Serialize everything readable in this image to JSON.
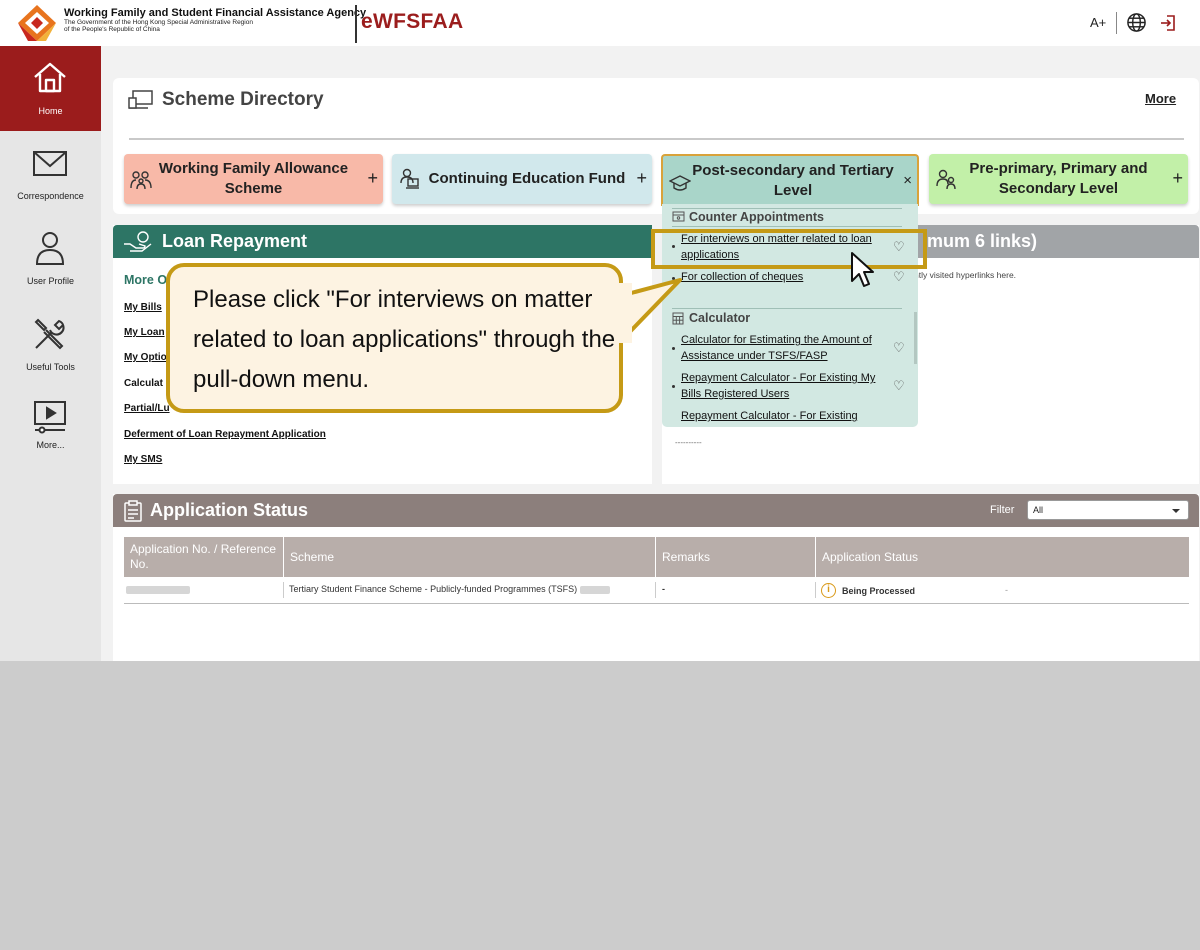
{
  "header": {
    "agency_name": "Working Family and Student Financial Assistance Agency",
    "agency_sub1": "The Government of the Hong Kong Special Administrative Region",
    "agency_sub2": "of the People's Republic of China",
    "brand": "eWFSFAA",
    "font_size_label": "A+"
  },
  "sidebar": {
    "items": [
      {
        "label": "Home",
        "icon": "home-icon",
        "active": true
      },
      {
        "label": "Correspondence",
        "icon": "envelope-icon"
      },
      {
        "label": "User Profile",
        "icon": "user-icon"
      },
      {
        "label": "Useful Tools",
        "icon": "tools-icon"
      },
      {
        "label": "More...",
        "icon": "video-icon"
      }
    ]
  },
  "scheme_directory": {
    "title": "Scheme Directory",
    "more": "More",
    "tiles": [
      {
        "label": "Working Family Allowance Scheme",
        "icon": "family-icon",
        "color": "#f8b9a8",
        "toggle": "+"
      },
      {
        "label": "Continuing Education Fund",
        "icon": "laptop-user-icon",
        "color": "#d1e8ec",
        "toggle": "+"
      },
      {
        "label": "Post-secondary and Tertiary Level",
        "icon": "graduation-cap-icon",
        "color": "#a9d5c9",
        "toggle": "×"
      },
      {
        "label": "Pre-primary, Primary and Secondary Level",
        "icon": "students-icon",
        "color": "#c2f0a8",
        "toggle": "+"
      }
    ]
  },
  "dropdown": {
    "sections": [
      {
        "title": "Counter Appointments",
        "links": [
          "For interviews on matter related to loan applications",
          "For collection of cheques"
        ]
      },
      {
        "title": "Calculator",
        "links": [
          "Calculator for Estimating the Amount of Assistance under TSFS/FASP",
          "Repayment Calculator - For Existing My Bills Registered Users",
          "Repayment Calculator - For Existing"
        ]
      }
    ]
  },
  "loan_repayment": {
    "title": "Loan Repayment",
    "more_heading": "More O",
    "links": [
      "My Bills",
      "My Loan",
      "My Optio",
      "Calculat",
      "Partial/Lu",
      "Deferment of Loan Repayment Application",
      "My SMS"
    ]
  },
  "quick_links": {
    "title_fragment": "imum 6 links)",
    "hint": "ntly visited hyperlinks here.",
    "placeholder": "----------"
  },
  "application_status": {
    "title": "Application Status",
    "filter_label": "Filter",
    "filter_value": "All",
    "columns": [
      "Application No. / Reference No.",
      "Scheme",
      "Remarks",
      "Application Status"
    ],
    "rows": [
      {
        "scheme": "Tertiary Student Finance Scheme - Publicly-funded Programmes (TSFS)",
        "remarks": "-",
        "status": "Being Processed",
        "extra": "-"
      }
    ]
  },
  "callout": {
    "text": "Please click \"For interviews on matter related to loan applications\" through the pull-down menu."
  },
  "colors": {
    "accent_red": "#9b1c1c",
    "loan_green": "#2d7565",
    "grey_bar": "#a1a4a7",
    "status_brown": "#8c7f7c",
    "highlight_gold": "#c59a16"
  }
}
